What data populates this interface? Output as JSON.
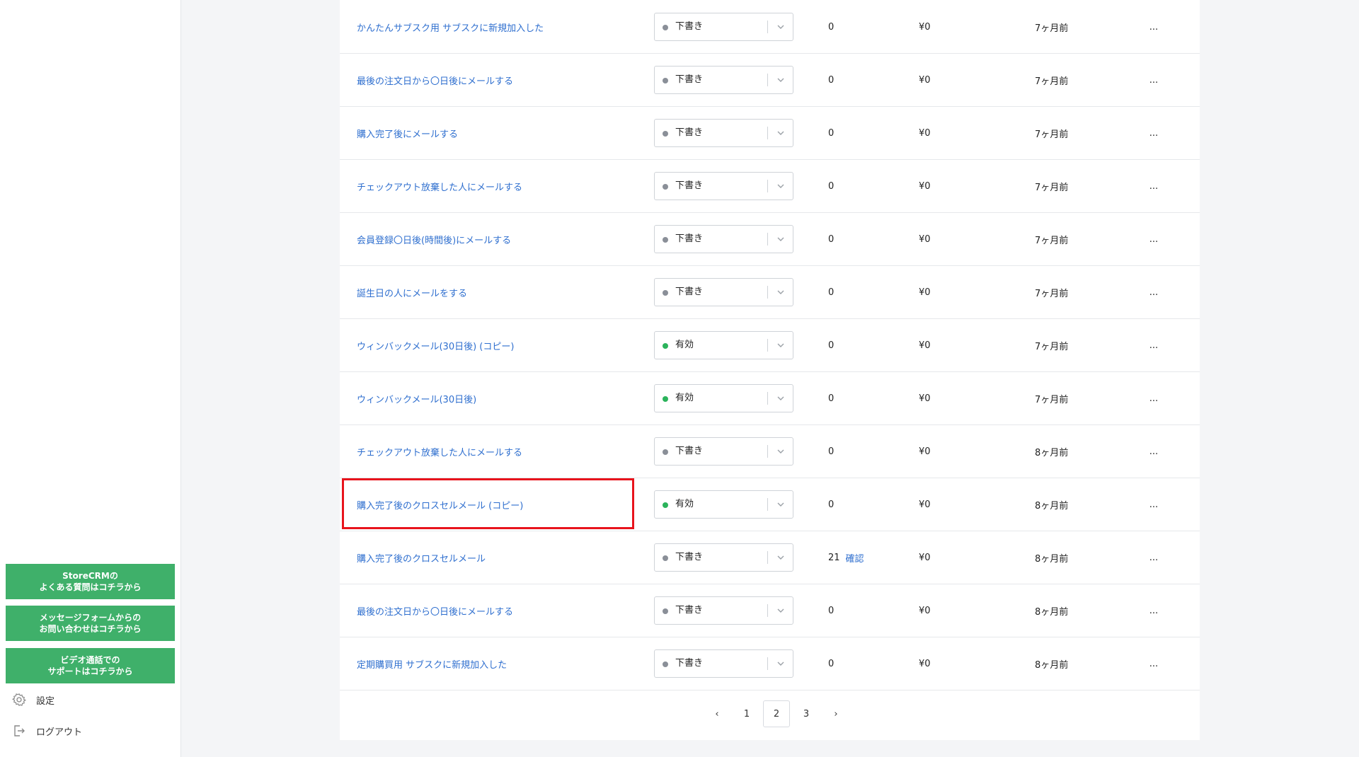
{
  "colors": {
    "accent": "#2f6fcf",
    "help_button": "#3fb06a",
    "status_draft": "#8a8f98",
    "status_active": "#2bb35b",
    "highlight": "#e8141c"
  },
  "sidebar": {
    "help_buttons": [
      {
        "label": "StoreCRMの\nよくある質問はコチラから"
      },
      {
        "label": "メッセージフォームからの\nお問い合わせはコチラから"
      },
      {
        "label": "ビデオ通話での\nサポートはコチラから"
      }
    ],
    "settings": {
      "label": "設定",
      "icon": "gear-icon"
    },
    "logout": {
      "label": "ログアウト",
      "icon": "logout-icon"
    }
  },
  "table": {
    "rows": [
      {
        "name": "かんたんサブスク用 サブスクに新規加入した",
        "status": "下書き",
        "status_type": "draft",
        "count": "0",
        "confirm": "",
        "revenue": "¥0",
        "updated": "7ヶ月前",
        "more": "..."
      },
      {
        "name": "最後の注文日から〇日後にメールする",
        "status": "下書き",
        "status_type": "draft",
        "count": "0",
        "confirm": "",
        "revenue": "¥0",
        "updated": "7ヶ月前",
        "more": "..."
      },
      {
        "name": "購入完了後にメールする",
        "status": "下書き",
        "status_type": "draft",
        "count": "0",
        "confirm": "",
        "revenue": "¥0",
        "updated": "7ヶ月前",
        "more": "..."
      },
      {
        "name": "チェックアウト放棄した人にメールする",
        "status": "下書き",
        "status_type": "draft",
        "count": "0",
        "confirm": "",
        "revenue": "¥0",
        "updated": "7ヶ月前",
        "more": "..."
      },
      {
        "name": "会員登録〇日後(時間後)にメールする",
        "status": "下書き",
        "status_type": "draft",
        "count": "0",
        "confirm": "",
        "revenue": "¥0",
        "updated": "7ヶ月前",
        "more": "..."
      },
      {
        "name": "誕生日の人にメールをする",
        "status": "下書き",
        "status_type": "draft",
        "count": "0",
        "confirm": "",
        "revenue": "¥0",
        "updated": "7ヶ月前",
        "more": "..."
      },
      {
        "name": "ウィンバックメール(30日後) (コピー)",
        "status": "有効",
        "status_type": "active",
        "count": "0",
        "confirm": "",
        "revenue": "¥0",
        "updated": "7ヶ月前",
        "more": "..."
      },
      {
        "name": "ウィンバックメール(30日後)",
        "status": "有効",
        "status_type": "active",
        "count": "0",
        "confirm": "",
        "revenue": "¥0",
        "updated": "7ヶ月前",
        "more": "..."
      },
      {
        "name": "チェックアウト放棄した人にメールする",
        "status": "下書き",
        "status_type": "draft",
        "count": "0",
        "confirm": "",
        "revenue": "¥0",
        "updated": "8ヶ月前",
        "more": "..."
      },
      {
        "name": "購入完了後のクロスセルメール (コピー)",
        "status": "有効",
        "status_type": "active",
        "count": "0",
        "confirm": "",
        "revenue": "¥0",
        "updated": "8ヶ月前",
        "more": "..."
      },
      {
        "name": "購入完了後のクロスセルメール",
        "status": "下書き",
        "status_type": "draft",
        "count": "21",
        "confirm": "確認",
        "revenue": "¥0",
        "updated": "8ヶ月前",
        "more": "..."
      },
      {
        "name": "最後の注文日から〇日後にメールする",
        "status": "下書き",
        "status_type": "draft",
        "count": "0",
        "confirm": "",
        "revenue": "¥0",
        "updated": "8ヶ月前",
        "more": "..."
      },
      {
        "name": "定期購買用 サブスクに新規加入した",
        "status": "下書き",
        "status_type": "draft",
        "count": "0",
        "confirm": "",
        "revenue": "¥0",
        "updated": "8ヶ月前",
        "more": "..."
      }
    ]
  },
  "pagination": {
    "prev": "‹",
    "pages": [
      "1",
      "2",
      "3"
    ],
    "current": "2",
    "next": "›"
  }
}
